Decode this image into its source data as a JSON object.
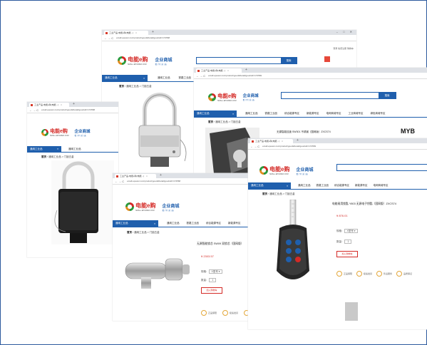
{
  "browser": {
    "tab_title": "工业产品-电能e购(电能...)",
    "tab_close": "×",
    "new_tab": "+",
    "window_controls": "–  □  ✕",
    "nav_icons": "←  →  C",
    "url_a": "emall.epower.com/product/goodsDetail/goodsId=174568",
    "url_b": "emall.epower.com/product/goodsDetail/goodsId=174569",
    "top_links": "登录  免费注册  购物车"
  },
  "brand": {
    "name": "电能",
    "mark": "e",
    "suffix": "购",
    "domain": "SMALL.EPOWER.COM",
    "enterprise": "企业商城",
    "enterprise_sub": "看 | 学 | 采 | 选"
  },
  "nav": {
    "category": "通用工业品",
    "menu_icon": "≡",
    "items": [
      "通用工业品",
      "铁路工业品",
      "综合能源专区",
      "新能源专区",
      "电网商城专区",
      "工业商城专区",
      "绿色商城专区"
    ]
  },
  "breadcrumb": {
    "home": "首页",
    "path": "通用工业品 > 门锁五金"
  },
  "search": {
    "button": "搜索"
  },
  "products": {
    "keypad": {
      "title": "电能易用锁匙 Y803 无源电子钥匙（国网版）ZXCS74",
      "price": "¥ 876.01",
      "qty_label": "数量：",
      "qty": "1",
      "spec_label": "规格：",
      "spec": "X型号 ▾",
      "buy": "加入购物车"
    },
    "cylinder": {
      "title": "无源智能锁芯 SW09 双锁芯（国网版）",
      "price": "¥ 2303.57",
      "qty_label": "数量：",
      "qty": "1",
      "spec_label": "规格：",
      "spec": "X型号 ▾",
      "buy": "加入购物车"
    },
    "padlock": {
      "title": "无源智能挂锁 SW301 不锈钢（国网版）ZXCS74"
    }
  },
  "services": [
    "正品保障",
    "极速发货",
    "售后服务",
    "品质保证"
  ],
  "watermark": "MYB",
  "colors": {
    "accent": "#1f5fad",
    "brand_red": "#d42a26",
    "brand_green": "#2a9a3c",
    "brand_orange": "#e08a1e",
    "frame": "#2d5a9e"
  }
}
